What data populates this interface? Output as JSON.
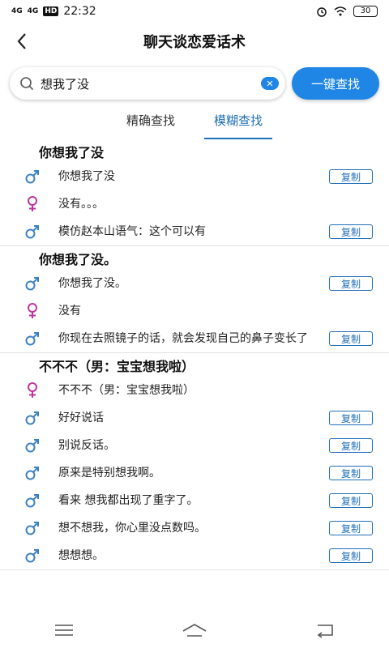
{
  "status_bar": {
    "net1": "4G",
    "net2": "4G",
    "hd": "HD",
    "time": "22:32",
    "battery": "30"
  },
  "app_bar": {
    "title": "聊天谈恋爱话术"
  },
  "search": {
    "value": "想我了没",
    "button_label": "一键查找"
  },
  "tabs": [
    {
      "label": "精确查找",
      "active": false
    },
    {
      "label": "模糊查找",
      "active": true
    }
  ],
  "copy_label": "复制",
  "groups": [
    {
      "title": "你想我了没",
      "items": [
        {
          "gender": "male",
          "text": "你想我了没",
          "copy": true
        },
        {
          "gender": "female",
          "text": "没有。。。",
          "copy": false
        },
        {
          "gender": "male",
          "text": "模仿赵本山语气：这个可以有",
          "copy": true
        }
      ]
    },
    {
      "title": "你想我了没。",
      "items": [
        {
          "gender": "male",
          "text": "你想我了没。",
          "copy": true
        },
        {
          "gender": "female",
          "text": "没有",
          "copy": false
        },
        {
          "gender": "male",
          "text": "你现在去照镜子的话，就会发现自己的鼻子变长了",
          "copy": true
        }
      ]
    },
    {
      "title": "不不不（男：宝宝想我啦）",
      "items": [
        {
          "gender": "female",
          "text": "不不不（男：宝宝想我啦）",
          "copy": false
        },
        {
          "gender": "male",
          "text": "好好说话",
          "copy": true
        },
        {
          "gender": "male",
          "text": "别说反话。",
          "copy": true
        },
        {
          "gender": "male",
          "text": "原来是特别想我啊。",
          "copy": true
        },
        {
          "gender": "male",
          "text": "看来 想我都出现了重字了。",
          "copy": true
        },
        {
          "gender": "male",
          "text": "想不想我，你心里没点数吗。",
          "copy": true
        },
        {
          "gender": "male",
          "text": "想想想。",
          "copy": true
        }
      ]
    }
  ],
  "colors": {
    "accent": "#1f86e6",
    "male": "#3b82c4",
    "female": "#c0339e"
  }
}
